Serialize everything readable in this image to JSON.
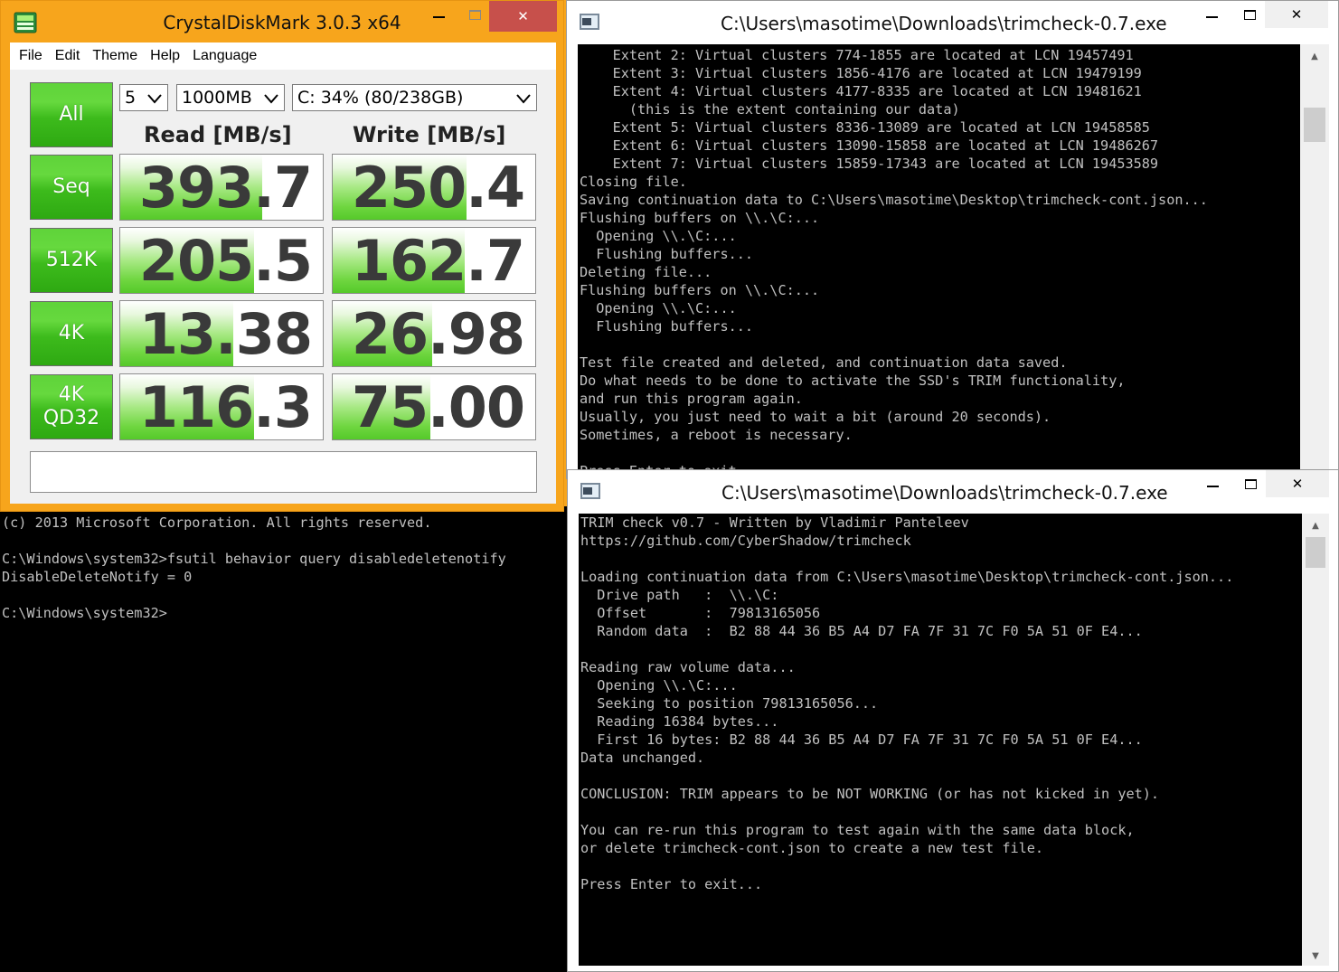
{
  "colors": {
    "desktop": "#f7a51c",
    "close_button": "#c7504b",
    "console_bg": "#000000",
    "console_text": "#c0c0c0",
    "accent_green": "#3dbb1c"
  },
  "cmd_window": {
    "lines": [
      "(c) 2013 Microsoft Corporation. All rights reserved.",
      "",
      "C:\\Windows\\system32>fsutil behavior query disabledeletenotify",
      "DisableDeleteNotify = 0",
      "",
      "C:\\Windows\\system32>"
    ]
  },
  "cdm": {
    "title": "CrystalDiskMark 3.0.3 x64",
    "menu": [
      "File",
      "Edit",
      "Theme",
      "Help",
      "Language"
    ],
    "buttons": {
      "all": "All",
      "seq": "Seq",
      "k512": "512K",
      "k4": "4K",
      "qd32_line1": "4K",
      "qd32_line2": "QD32"
    },
    "count_select": "5",
    "size_select": "1000MB",
    "drive_select": "C: 34% (80/238GB)",
    "read_header": "Read [MB/s]",
    "write_header": "Write [MB/s]",
    "results": {
      "seq_read": "393.7",
      "seq_write": "250.4",
      "k512_read": "205.5",
      "k512_write": "162.7",
      "k4_read": "13.38",
      "k4_write": "26.98",
      "k4qd32_read": "116.3",
      "k4qd32_write": "75.00"
    },
    "bar_fill": {
      "seq_read": 0.7,
      "seq_write": 0.66,
      "k512_read": 0.66,
      "k512_write": 0.65,
      "k4_read": 0.56,
      "k4_write": 0.49,
      "k4qd32_read": 0.66,
      "k4qd32_write": 0.48
    }
  },
  "trim1": {
    "title": "C:\\Users\\masotime\\Downloads\\trimcheck-0.7.exe",
    "lines": [
      "    Extent 2: Virtual clusters 774-1855 are located at LCN 19457491",
      "    Extent 3: Virtual clusters 1856-4176 are located at LCN 19479199",
      "    Extent 4: Virtual clusters 4177-8335 are located at LCN 19481621",
      "      (this is the extent containing our data)",
      "    Extent 5: Virtual clusters 8336-13089 are located at LCN 19458585",
      "    Extent 6: Virtual clusters 13090-15858 are located at LCN 19486267",
      "    Extent 7: Virtual clusters 15859-17343 are located at LCN 19453589",
      "Closing file.",
      "Saving continuation data to C:\\Users\\masotime\\Desktop\\trimcheck-cont.json...",
      "Flushing buffers on \\\\.\\C:...",
      "  Opening \\\\.\\C:...",
      "  Flushing buffers...",
      "Deleting file...",
      "Flushing buffers on \\\\.\\C:...",
      "  Opening \\\\.\\C:...",
      "  Flushing buffers...",
      "",
      "Test file created and deleted, and continuation data saved.",
      "Do what needs to be done to activate the SSD's TRIM functionality,",
      "and run this program again.",
      "Usually, you just need to wait a bit (around 20 seconds).",
      "Sometimes, a reboot is necessary.",
      "",
      "Press Enter to exit..."
    ]
  },
  "trim2": {
    "title": "C:\\Users\\masotime\\Downloads\\trimcheck-0.7.exe",
    "lines": [
      "TRIM check v0.7 - Written by Vladimir Panteleev",
      "https://github.com/CyberShadow/trimcheck",
      "",
      "Loading continuation data from C:\\Users\\masotime\\Desktop\\trimcheck-cont.json...",
      "  Drive path   :  \\\\.\\C:",
      "  Offset       :  79813165056",
      "  Random data  :  B2 88 44 36 B5 A4 D7 FA 7F 31 7C F0 5A 51 0F E4...",
      "",
      "Reading raw volume data...",
      "  Opening \\\\.\\C:...",
      "  Seeking to position 79813165056...",
      "  Reading 16384 bytes...",
      "  First 16 bytes: B2 88 44 36 B5 A4 D7 FA 7F 31 7C F0 5A 51 0F E4...",
      "Data unchanged.",
      "",
      "CONCLUSION: TRIM appears to be NOT WORKING (or has not kicked in yet).",
      "",
      "You can re-run this program to test again with the same data block,",
      "or delete trimcheck-cont.json to create a new test file.",
      "",
      "Press Enter to exit..."
    ]
  }
}
